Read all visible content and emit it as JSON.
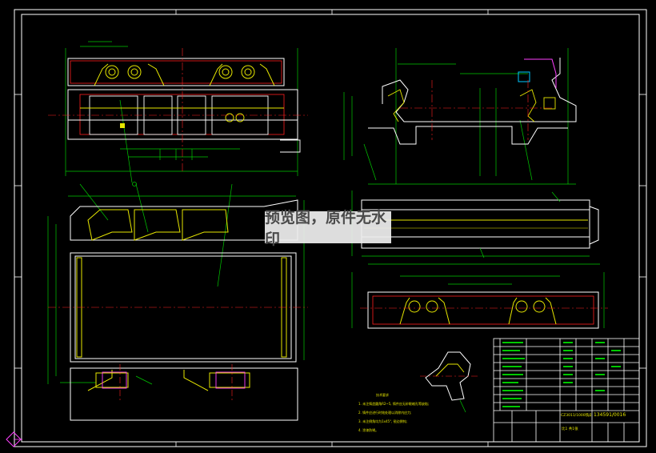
{
  "watermark": {
    "text": "预览图，原件无水印"
  },
  "notes": {
    "heading": "技术要求",
    "items": [
      "1. 未注铸造圆角R2~5, 铸件应无砂眼缩孔等缺陷;",
      "2. 铸件应进行时效处理以消除内应力;",
      "3. 未注倒角均为1x45°, 锐边倒钝;",
      "4. 涂漆防锈。"
    ]
  },
  "title_block": {
    "drawing_name": "CZ3011/1000铣床床身",
    "drawing_code": "134591/0016",
    "sheet_label": "比1 共1张"
  },
  "colors": {
    "background": "#000000",
    "outline": "#ffffff",
    "green": "#00c800",
    "yellow": "#e6e600",
    "red": "#ff2020",
    "cyan": "#00c8ff",
    "magenta": "#ff40ff"
  }
}
